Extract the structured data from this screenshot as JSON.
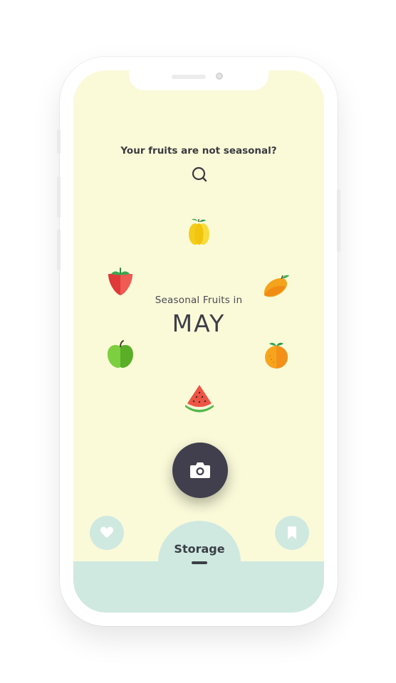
{
  "header": {
    "question": "Your fruits are not seasonal?"
  },
  "center": {
    "subtitle": "Seasonal Fruits in",
    "month": "MAY"
  },
  "fruits": [
    "lemon",
    "mango",
    "orange",
    "watermelon",
    "apple",
    "strawberry"
  ],
  "bottom_nav": {
    "storage_label": "Storage"
  },
  "colors": {
    "screen_bg": "#fafad9",
    "nav_bg": "#cfe9e1",
    "camera_button": "#413f4d"
  },
  "icons": [
    "search-icon",
    "camera-icon",
    "heart-icon",
    "bookmark-icon"
  ]
}
